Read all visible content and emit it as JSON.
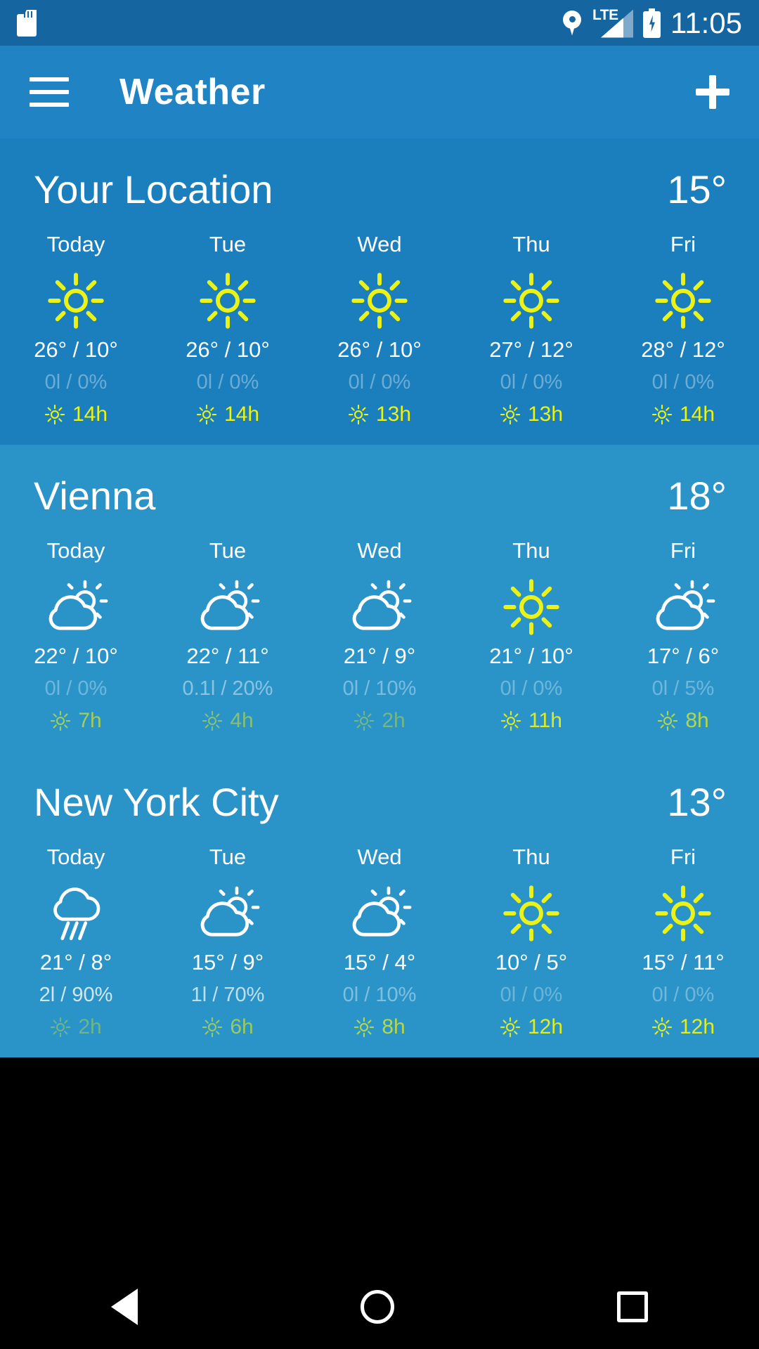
{
  "statusbar": {
    "time": "11:05",
    "network_label": "LTE",
    "icons": [
      "sd-card-icon",
      "location-pin-icon",
      "lte-signal-icon",
      "battery-charging-icon"
    ]
  },
  "appbar": {
    "title": "Weather",
    "menu_icon": "hamburger-menu-icon",
    "add_icon": "plus-icon"
  },
  "colors": {
    "status_bar": "#1565a0",
    "app_bar": "#1f83c4",
    "section_dark": "#1b7fbd",
    "section_light": "#2a94c9",
    "accent_sun": "#eaf218",
    "text": "#ffffff"
  },
  "sections": [
    {
      "name": "Your Location",
      "current_temp": "15°",
      "bg": "#1b7fbd",
      "days": [
        {
          "day": "Today",
          "icon": "sun-icon",
          "temps": "26° / 10°",
          "precip": "0l / 0%",
          "precip_opacity": 0.35,
          "sun": "14h",
          "sun_opacity": 1.0
        },
        {
          "day": "Tue",
          "icon": "sun-icon",
          "temps": "26° / 10°",
          "precip": "0l / 0%",
          "precip_opacity": 0.35,
          "sun": "14h",
          "sun_opacity": 1.0
        },
        {
          "day": "Wed",
          "icon": "sun-icon",
          "temps": "26° / 10°",
          "precip": "0l / 0%",
          "precip_opacity": 0.35,
          "sun": "13h",
          "sun_opacity": 1.0
        },
        {
          "day": "Thu",
          "icon": "sun-icon",
          "temps": "27° / 12°",
          "precip": "0l / 0%",
          "precip_opacity": 0.35,
          "sun": "13h",
          "sun_opacity": 1.0
        },
        {
          "day": "Fri",
          "icon": "sun-icon",
          "temps": "28° / 12°",
          "precip": "0l / 0%",
          "precip_opacity": 0.35,
          "sun": "14h",
          "sun_opacity": 1.0
        }
      ]
    },
    {
      "name": "Vienna",
      "current_temp": "18°",
      "bg": "#2a94c9",
      "days": [
        {
          "day": "Today",
          "icon": "partly-cloudy-icon",
          "temps": "22° / 10°",
          "precip": "0l / 0%",
          "precip_opacity": 0.32,
          "sun": "7h",
          "sun_opacity": 0.62
        },
        {
          "day": "Tue",
          "icon": "partly-cloudy-icon",
          "temps": "22° / 11°",
          "precip": "0.1l / 20%",
          "precip_opacity": 0.45,
          "sun": "4h",
          "sun_opacity": 0.48
        },
        {
          "day": "Wed",
          "icon": "partly-cloudy-icon",
          "temps": "21° / 9°",
          "precip": "0l / 10%",
          "precip_opacity": 0.38,
          "sun": "2h",
          "sun_opacity": 0.38
        },
        {
          "day": "Thu",
          "icon": "sun-icon",
          "temps": "21° / 10°",
          "precip": "0l / 0%",
          "precip_opacity": 0.32,
          "sun": "11h",
          "sun_opacity": 0.92
        },
        {
          "day": "Fri",
          "icon": "partly-cloudy-icon",
          "temps": "17° / 6°",
          "precip": "0l / 5%",
          "precip_opacity": 0.32,
          "sun": "8h",
          "sun_opacity": 0.7
        }
      ]
    },
    {
      "name": "New York City",
      "current_temp": "13°",
      "bg": "#2a94c9",
      "days": [
        {
          "day": "Today",
          "icon": "rain-icon",
          "temps": "21° / 8°",
          "precip": "2l / 90%",
          "precip_opacity": 0.78,
          "sun": "2h",
          "sun_opacity": 0.35
        },
        {
          "day": "Tue",
          "icon": "partly-cloudy-icon",
          "temps": "15° / 9°",
          "precip": "1l / 70%",
          "precip_opacity": 0.7,
          "sun": "6h",
          "sun_opacity": 0.58
        },
        {
          "day": "Wed",
          "icon": "partly-cloudy-icon",
          "temps": "15° / 4°",
          "precip": "0l / 10%",
          "precip_opacity": 0.4,
          "sun": "8h",
          "sun_opacity": 0.72
        },
        {
          "day": "Thu",
          "icon": "sun-icon",
          "temps": "10° / 5°",
          "precip": "0l / 0%",
          "precip_opacity": 0.3,
          "sun": "12h",
          "sun_opacity": 0.95
        },
        {
          "day": "Fri",
          "icon": "sun-icon",
          "temps": "15° / 11°",
          "precip": "0l / 0%",
          "precip_opacity": 0.32,
          "sun": "12h",
          "sun_opacity": 0.95
        }
      ]
    }
  ],
  "navbar": {
    "back": "back-nav-icon",
    "home": "home-nav-icon",
    "recents": "recents-nav-icon"
  }
}
